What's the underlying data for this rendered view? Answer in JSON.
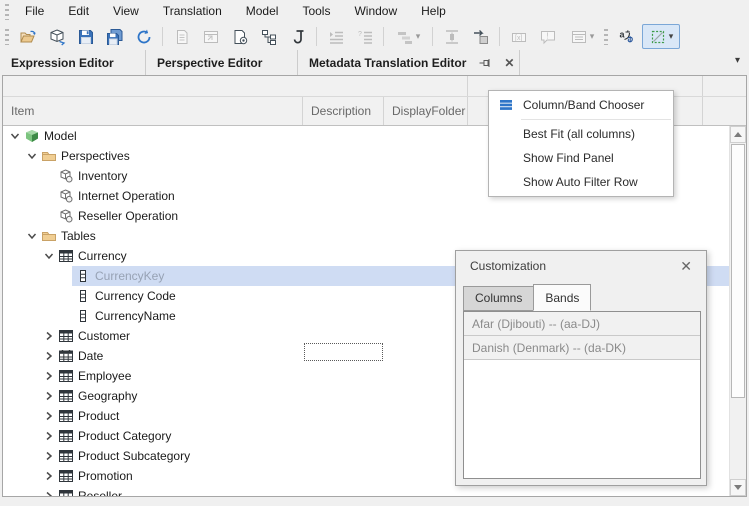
{
  "menubar": {
    "items": [
      "File",
      "Edit",
      "View",
      "Translation",
      "Model",
      "Tools",
      "Window",
      "Help"
    ]
  },
  "toolbar": {
    "buttons": [
      {
        "name": "open-button",
        "icon": "open-icon",
        "enabled": true
      },
      {
        "name": "deploy-model-button",
        "icon": "deploy-cube-icon",
        "enabled": true
      },
      {
        "name": "save-button",
        "icon": "save-icon",
        "enabled": true
      },
      {
        "name": "save-all-button",
        "icon": "save-all-icon",
        "enabled": true
      },
      {
        "name": "refresh-button",
        "icon": "refresh-icon",
        "enabled": true
      },
      {
        "sep": true
      },
      {
        "name": "document-button",
        "icon": "document-icon",
        "enabled": false
      },
      {
        "name": "preview-button",
        "icon": "preview-window-icon",
        "enabled": false
      },
      {
        "name": "script-button",
        "icon": "script-page-icon",
        "enabled": true
      },
      {
        "name": "hierarchy-button",
        "icon": "hierarchy-icon",
        "enabled": true
      },
      {
        "name": "json-script-button",
        "icon": "bracket-icon",
        "enabled": true
      },
      {
        "sep": true
      },
      {
        "name": "indent-button",
        "icon": "indent-lines-icon",
        "enabled": false
      },
      {
        "name": "numbered-list-button",
        "icon": "numbered-list-icon",
        "enabled": false
      },
      {
        "sep": true
      },
      {
        "name": "layout-button",
        "icon": "layout-bars-icon",
        "enabled": false,
        "caret": true
      },
      {
        "sep": true
      },
      {
        "name": "fit-height-button",
        "icon": "fit-height-icon",
        "enabled": false
      },
      {
        "name": "goto-button",
        "icon": "goto-arrow-icon",
        "enabled": true
      },
      {
        "sep": true
      },
      {
        "name": "textbox-button",
        "icon": "textbox-icon",
        "enabled": false
      },
      {
        "name": "comment-button",
        "icon": "comment-icon",
        "enabled": false
      },
      {
        "name": "form-button",
        "icon": "form-grid-icon",
        "enabled": false,
        "caret": true
      },
      {
        "grip": true
      },
      {
        "name": "translate-button",
        "icon": "translate-icon",
        "enabled": true
      },
      {
        "name": "highlight-cells-toggle",
        "icon": "dashed-box-icon",
        "enabled": true,
        "active": true,
        "caret": true
      }
    ],
    "caret_glyph": "▾"
  },
  "tabbar": {
    "tabs": [
      {
        "label": "Expression Editor",
        "active": false
      },
      {
        "label": "Perspective Editor",
        "active": false
      },
      {
        "label": "Metadata Translation Editor",
        "active": true
      }
    ],
    "close_glyph": "✕",
    "overflow_glyph": "▾"
  },
  "grid": {
    "columns": [
      {
        "label": "Item"
      },
      {
        "label": "Description"
      },
      {
        "label": "DisplayFolder"
      },
      {
        "label": ""
      },
      {
        "label": ""
      }
    ],
    "rows": [
      {
        "label": "Model",
        "level": 0,
        "chevron": "down",
        "icon": "model-icon"
      },
      {
        "label": "Perspectives",
        "level": 1,
        "chevron": "down",
        "icon": "folder-icon"
      },
      {
        "label": "Inventory",
        "level": 2,
        "chevron": "none",
        "icon": "perspective-icon"
      },
      {
        "label": "Internet Operation",
        "level": 2,
        "chevron": "none",
        "icon": "perspective-icon"
      },
      {
        "label": "Reseller Operation",
        "level": 2,
        "chevron": "none",
        "icon": "perspective-icon"
      },
      {
        "label": "Tables",
        "level": 1,
        "chevron": "down",
        "icon": "folder-icon"
      },
      {
        "label": "Currency",
        "level": 2,
        "chevron": "down",
        "icon": "table-icon"
      },
      {
        "label": "CurrencyKey",
        "level": 3,
        "chevron": "none",
        "icon": "column-icon",
        "selected": true
      },
      {
        "label": "Currency Code",
        "level": 3,
        "chevron": "none",
        "icon": "column-icon"
      },
      {
        "label": "CurrencyName",
        "level": 3,
        "chevron": "none",
        "icon": "column-icon"
      },
      {
        "label": "Customer",
        "level": 2,
        "chevron": "right",
        "icon": "table-icon"
      },
      {
        "label": "Date",
        "level": 2,
        "chevron": "right",
        "icon": "calendar-table-icon"
      },
      {
        "label": "Employee",
        "level": 2,
        "chevron": "right",
        "icon": "table-icon"
      },
      {
        "label": "Geography",
        "level": 2,
        "chevron": "right",
        "icon": "table-icon"
      },
      {
        "label": "Product",
        "level": 2,
        "chevron": "right",
        "icon": "table-icon"
      },
      {
        "label": "Product Category",
        "level": 2,
        "chevron": "right",
        "icon": "table-icon"
      },
      {
        "label": "Product Subcategory",
        "level": 2,
        "chevron": "right",
        "icon": "table-icon"
      },
      {
        "label": "Promotion",
        "level": 2,
        "chevron": "right",
        "icon": "table-icon"
      },
      {
        "label": "Reseller",
        "level": 2,
        "chevron": "right",
        "icon": "table-icon"
      }
    ]
  },
  "context_menu": {
    "items": [
      {
        "label": "Column/Band Chooser",
        "icon": "column-band-chooser-icon"
      },
      {
        "label": "Best Fit (all columns)"
      },
      {
        "label": "Show Find Panel"
      },
      {
        "label": "Show Auto Filter Row"
      }
    ],
    "separator_after": 0
  },
  "customization": {
    "title": "Customization",
    "close_glyph": "✕",
    "tabs": [
      {
        "label": "Columns",
        "active": false
      },
      {
        "label": "Bands",
        "active": true
      }
    ],
    "bands": [
      "Afar (Djibouti) -- (aa-DJ)",
      "Danish (Denmark) -- (da-DK)"
    ]
  },
  "colors": {
    "selection_bg": "#cfdcf3",
    "accent_blue": "#2e75c8",
    "folder_tan": "#f0ce93",
    "model_green": "#57a85c",
    "toggle_active_bg": "#d9e7f7",
    "toggle_active_border": "#7ba7d7"
  }
}
